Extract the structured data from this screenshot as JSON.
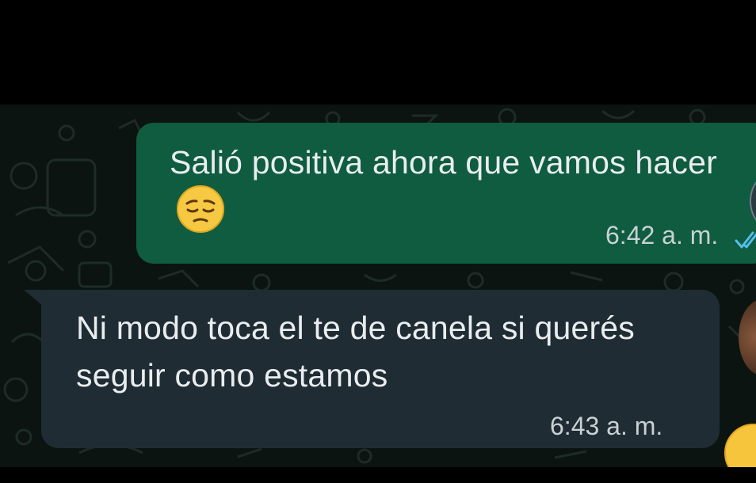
{
  "messages": [
    {
      "direction": "outgoing",
      "text": "Salió positiva ahora que vamos hacer",
      "emoji": "pensive-face-emoji",
      "time": "6:42 a. m.",
      "status": "delivered-check"
    },
    {
      "direction": "incoming",
      "text": "Ni modo toca el te de canela si querés seguir como estamos",
      "time": "6:43 a. m."
    }
  ],
  "colors": {
    "background": "#0b1410",
    "outgoing_bubble": "#0f5c40",
    "incoming_bubble": "#1f2c33",
    "text": "#e9edef",
    "time": "#c9d1d4",
    "tick": "#53bdeb"
  }
}
